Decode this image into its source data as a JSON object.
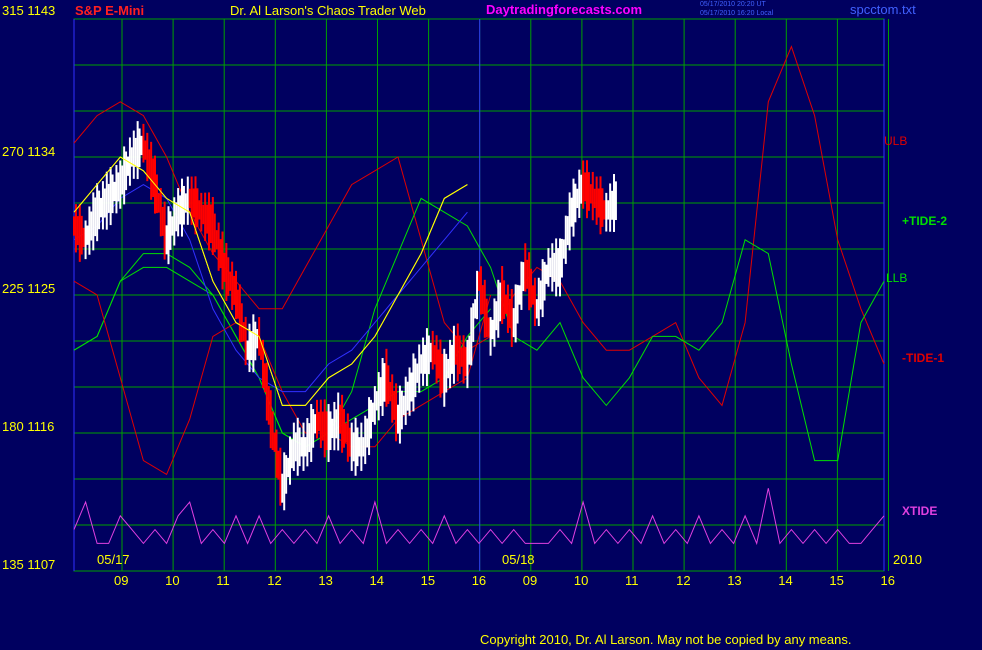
{
  "header": {
    "symbol": "S&P E-Mini",
    "title": "Dr. Al Larson's Chaos Trader Web",
    "site": "Daytradingforecasts.com",
    "stamp_line1": "05/17/2010 20:20 UT",
    "stamp_line2": "05/17/2010 16:20 Local",
    "filename": "spcctom.txt"
  },
  "footer": {
    "copyright": "Copyright 2010, Dr. Al Larson. May not be copied by any means."
  },
  "colors": {
    "background": "#000060",
    "grid": "#00a000",
    "ulb": "#e00000",
    "llb": "#00e000",
    "xtide": "#e040e0",
    "blue_line": "#3030ff",
    "yellow_line": "#ffff00",
    "axis_text": "#ffff00",
    "site_text": "#ff00ff"
  },
  "chart_data": {
    "type": "line",
    "y_left_labels": [
      {
        "index": "315",
        "price": "1143"
      },
      {
        "index": "270",
        "price": "1134"
      },
      {
        "index": "225",
        "price": "1125"
      },
      {
        "index": "180",
        "price": "1116"
      },
      {
        "index": "135",
        "price": "1107"
      }
    ],
    "x_date_labels": [
      "05/17",
      "05/18"
    ],
    "x_hour_ticks": [
      "09",
      "10",
      "11",
      "12",
      "13",
      "14",
      "15",
      "16",
      "09",
      "10",
      "11",
      "12",
      "13",
      "14",
      "15",
      "16"
    ],
    "year_label": "2010",
    "ylim": [
      1107,
      1147
    ],
    "series": [
      {
        "name": "ULB",
        "color": "#e00000",
        "points": [
          [
            0,
            1138
          ],
          [
            1,
            1140
          ],
          [
            2,
            1141
          ],
          [
            3,
            1140
          ],
          [
            4,
            1137
          ],
          [
            5,
            1133
          ],
          [
            6,
            1130
          ],
          [
            7,
            1128
          ],
          [
            8,
            1126
          ],
          [
            9,
            1126
          ],
          [
            10,
            1129
          ],
          [
            11,
            1132
          ],
          [
            12,
            1135
          ],
          [
            13,
            1136
          ],
          [
            14,
            1137
          ],
          [
            15,
            1131
          ],
          [
            16,
            1125
          ],
          [
            17,
            1123
          ],
          [
            18,
            1124
          ],
          [
            19,
            1127
          ],
          [
            20,
            1129
          ],
          [
            21,
            1128
          ],
          [
            22,
            1125
          ],
          [
            23,
            1123
          ],
          [
            24,
            1123
          ],
          [
            25,
            1124
          ],
          [
            26,
            1125
          ],
          [
            27,
            1121
          ],
          [
            28,
            1119
          ],
          [
            29,
            1125
          ],
          [
            30,
            1141
          ],
          [
            31,
            1145
          ],
          [
            32,
            1140
          ],
          [
            33,
            1131
          ],
          [
            34,
            1126
          ],
          [
            35,
            1122
          ]
        ]
      },
      {
        "name": "+TIDE-2",
        "color": "#00e000",
        "points": [
          [
            0,
            1123
          ],
          [
            1,
            1124
          ],
          [
            2,
            1128
          ],
          [
            3,
            1130
          ],
          [
            4,
            1130
          ],
          [
            5,
            1129
          ],
          [
            6,
            1127
          ],
          [
            7,
            1124
          ],
          [
            8,
            1121
          ],
          [
            9,
            1117
          ],
          [
            10,
            1116
          ],
          [
            11,
            1117
          ],
          [
            12,
            1120
          ],
          [
            13,
            1126
          ],
          [
            14,
            1130
          ],
          [
            15,
            1134
          ],
          [
            16,
            1133
          ],
          [
            17,
            1132
          ],
          [
            18,
            1129
          ],
          [
            19,
            1124
          ],
          [
            20,
            1123
          ],
          [
            21,
            1125
          ],
          [
            22,
            1121
          ],
          [
            23,
            1119
          ],
          [
            24,
            1121
          ],
          [
            25,
            1124
          ],
          [
            26,
            1124
          ],
          [
            27,
            1123
          ],
          [
            28,
            1125
          ],
          [
            29,
            1131
          ],
          [
            30,
            1130
          ],
          [
            31,
            1122
          ],
          [
            32,
            1115
          ],
          [
            33,
            1115
          ],
          [
            34,
            1125
          ],
          [
            35,
            1128
          ]
        ]
      },
      {
        "name": "LLB",
        "color": "#00e000",
        "points": [
          [
            0,
            1123
          ],
          [
            1,
            1124
          ],
          [
            2,
            1128
          ],
          [
            3,
            1129
          ],
          [
            4,
            1129
          ],
          [
            5,
            1128
          ],
          [
            6,
            1127
          ],
          [
            7,
            1124
          ],
          [
            8,
            1121
          ],
          [
            9,
            1117
          ],
          [
            10,
            1116
          ],
          [
            11,
            1117
          ],
          [
            12,
            1118
          ],
          [
            13,
            1119
          ],
          [
            14,
            1120
          ],
          [
            15,
            1120
          ],
          [
            16,
            1121
          ],
          [
            17,
            1124
          ],
          [
            18,
            1126
          ]
        ]
      },
      {
        "name": "-TIDE-1",
        "color": "#e00000",
        "points": [
          [
            0,
            1128
          ],
          [
            1,
            1127
          ],
          [
            2,
            1121
          ],
          [
            3,
            1115
          ],
          [
            4,
            1114
          ],
          [
            5,
            1118
          ],
          [
            6,
            1124
          ],
          [
            7,
            1125
          ],
          [
            8,
            1124
          ],
          [
            9,
            1120
          ],
          [
            10,
            1117
          ],
          [
            11,
            1117
          ],
          [
            12,
            1116
          ],
          [
            13,
            1116
          ],
          [
            14,
            1118
          ],
          [
            15,
            1119
          ],
          [
            16,
            1120
          ],
          [
            17,
            1121
          ],
          [
            18,
            1127
          ]
        ]
      },
      {
        "name": "Blue",
        "color": "#3030ff",
        "points": [
          [
            0,
            1131
          ],
          [
            1,
            1132
          ],
          [
            2,
            1134
          ],
          [
            3,
            1135
          ],
          [
            4,
            1134
          ],
          [
            5,
            1131
          ],
          [
            6,
            1126
          ],
          [
            7,
            1123
          ],
          [
            8,
            1121
          ],
          [
            9,
            1120
          ],
          [
            10,
            1120
          ],
          [
            11,
            1122
          ],
          [
            12,
            1123
          ],
          [
            13,
            1125
          ],
          [
            14,
            1127
          ],
          [
            15,
            1129
          ],
          [
            16,
            1131
          ],
          [
            17,
            1133
          ]
        ]
      },
      {
        "name": "Yellow",
        "color": "#ffff00",
        "points": [
          [
            0,
            1133
          ],
          [
            1,
            1135
          ],
          [
            2,
            1137
          ],
          [
            3,
            1136
          ],
          [
            4,
            1134
          ],
          [
            5,
            1133
          ],
          [
            6,
            1128
          ],
          [
            7,
            1125
          ],
          [
            8,
            1124
          ],
          [
            9,
            1119
          ],
          [
            10,
            1119
          ],
          [
            11,
            1121
          ],
          [
            12,
            1122
          ],
          [
            13,
            1124
          ],
          [
            14,
            1127
          ],
          [
            15,
            1130
          ],
          [
            16,
            1134
          ],
          [
            17,
            1135
          ]
        ]
      },
      {
        "name": "XTIDE",
        "color": "#e040e0",
        "points": [
          [
            0,
            1110
          ],
          [
            0.5,
            1112
          ],
          [
            1,
            1109
          ],
          [
            1.5,
            1109
          ],
          [
            2,
            1111
          ],
          [
            2.5,
            1110
          ],
          [
            3,
            1109
          ],
          [
            3.5,
            1110
          ],
          [
            4,
            1109
          ],
          [
            4.5,
            1111
          ],
          [
            5,
            1112
          ],
          [
            5.5,
            1109
          ],
          [
            6,
            1110
          ],
          [
            6.5,
            1109
          ],
          [
            7,
            1111
          ],
          [
            7.5,
            1109
          ],
          [
            8,
            1111
          ],
          [
            8.5,
            1109
          ],
          [
            9,
            1110
          ],
          [
            9.5,
            1109
          ],
          [
            10,
            1110
          ],
          [
            10.5,
            1109
          ],
          [
            11,
            1111
          ],
          [
            11.5,
            1109
          ],
          [
            12,
            1110
          ],
          [
            12.5,
            1109
          ],
          [
            13,
            1112
          ],
          [
            13.5,
            1109
          ],
          [
            14,
            1110
          ],
          [
            14.5,
            1109
          ],
          [
            15,
            1110
          ],
          [
            15.5,
            1109
          ],
          [
            16,
            1111
          ],
          [
            16.5,
            1109
          ],
          [
            17,
            1110
          ],
          [
            17.5,
            1109
          ],
          [
            18,
            1110
          ],
          [
            18.5,
            1109
          ],
          [
            19,
            1110
          ],
          [
            19.5,
            1109
          ],
          [
            20,
            1109
          ],
          [
            20.5,
            1109
          ],
          [
            21,
            1110
          ],
          [
            21.5,
            1109
          ],
          [
            22,
            1112
          ],
          [
            22.5,
            1109
          ],
          [
            23,
            1110
          ],
          [
            23.5,
            1109
          ],
          [
            24,
            1110
          ],
          [
            24.5,
            1109
          ],
          [
            25,
            1111
          ],
          [
            25.5,
            1109
          ],
          [
            26,
            1110
          ],
          [
            26.5,
            1109
          ],
          [
            27,
            1111
          ],
          [
            27.5,
            1109
          ],
          [
            28,
            1110
          ],
          [
            28.5,
            1109
          ],
          [
            29,
            1111
          ],
          [
            29.5,
            1109
          ],
          [
            30,
            1113
          ],
          [
            30.5,
            1109
          ],
          [
            31,
            1110
          ],
          [
            31.5,
            1109
          ],
          [
            32,
            1110
          ],
          [
            32.5,
            1109
          ],
          [
            33,
            1110
          ],
          [
            33.5,
            1109
          ],
          [
            34,
            1109
          ],
          [
            34.5,
            1110
          ],
          [
            35,
            1111
          ]
        ]
      }
    ],
    "price_path": [
      [
        0,
        1132
      ],
      [
        0.5,
        1131
      ],
      [
        1,
        1133
      ],
      [
        1.5,
        1134
      ],
      [
        2,
        1135
      ],
      [
        2.5,
        1137
      ],
      [
        3,
        1138
      ],
      [
        3.5,
        1135
      ],
      [
        4,
        1131
      ],
      [
        4.5,
        1133
      ],
      [
        5,
        1134
      ],
      [
        5.5,
        1133
      ],
      [
        6,
        1132
      ],
      [
        6.5,
        1129
      ],
      [
        7,
        1127
      ],
      [
        7.5,
        1123
      ],
      [
        8,
        1124
      ],
      [
        8.5,
        1118
      ],
      [
        9,
        1113
      ],
      [
        9.5,
        1116
      ],
      [
        10,
        1116
      ],
      [
        10.5,
        1118
      ],
      [
        11,
        1117
      ],
      [
        11.5,
        1118
      ],
      [
        12,
        1116
      ],
      [
        12.5,
        1116
      ],
      [
        13,
        1119
      ],
      [
        13.5,
        1121
      ],
      [
        14,
        1118
      ],
      [
        14.5,
        1120
      ],
      [
        15,
        1122
      ],
      [
        15.5,
        1123
      ],
      [
        16,
        1121
      ],
      [
        16.5,
        1123
      ],
      [
        17,
        1122
      ],
      [
        17.5,
        1128
      ],
      [
        18,
        1124
      ],
      [
        18.5,
        1127
      ],
      [
        19,
        1125
      ],
      [
        19.5,
        1129
      ],
      [
        20,
        1126
      ],
      [
        20.5,
        1129
      ],
      [
        21,
        1129
      ],
      [
        21.5,
        1133
      ],
      [
        22,
        1135
      ],
      [
        22.5,
        1134
      ],
      [
        23,
        1133
      ],
      [
        23.5,
        1134
      ]
    ]
  },
  "series_labels": [
    {
      "key": "ulb",
      "text": "ULB"
    },
    {
      "key": "tide2",
      "text": "+TIDE-2"
    },
    {
      "key": "llb",
      "text": "LLB"
    },
    {
      "key": "tide1",
      "text": "-TIDE-1"
    },
    {
      "key": "xtide",
      "text": "XTIDE"
    }
  ]
}
